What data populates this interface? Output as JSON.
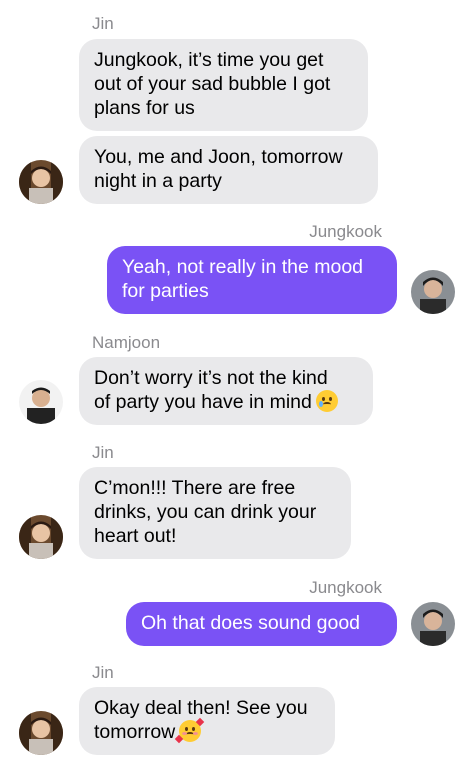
{
  "colors": {
    "incoming_bubble": "#e9e9eb",
    "outgoing_bubble": "#7a52f5",
    "sender_name": "#8a8a8e"
  },
  "messages": [
    {
      "sender": "Jin",
      "side": "left",
      "lines": [
        "Jungkook, it’s time you get",
        "out of your sad bubble I got",
        "plans for us"
      ]
    },
    {
      "sender": "",
      "side": "left",
      "lines": [
        "You, me and Joon, tomorrow",
        "night in a party"
      ]
    },
    {
      "sender": "Jungkook",
      "side": "right",
      "lines": [
        "Yeah, not really in the mood",
        "for parties"
      ]
    },
    {
      "sender": "Namjoon",
      "side": "left",
      "lines": [
        "Don’t worry it’s not the kind",
        "of party you have in mind"
      ],
      "emoji": "crying-face-icon"
    },
    {
      "sender": "Jin",
      "side": "left",
      "lines": [
        "C’mon!!! There are free",
        "drinks, you can drink your",
        "heart out!"
      ]
    },
    {
      "sender": "Jungkook",
      "side": "right",
      "lines": [
        "Oh that does sound good"
      ]
    },
    {
      "sender": "Jin",
      "side": "left",
      "lines": [
        "Okay deal then! See you",
        "tomorrow"
      ],
      "emoji": "smiling-face-with-hearts-icon"
    }
  ]
}
